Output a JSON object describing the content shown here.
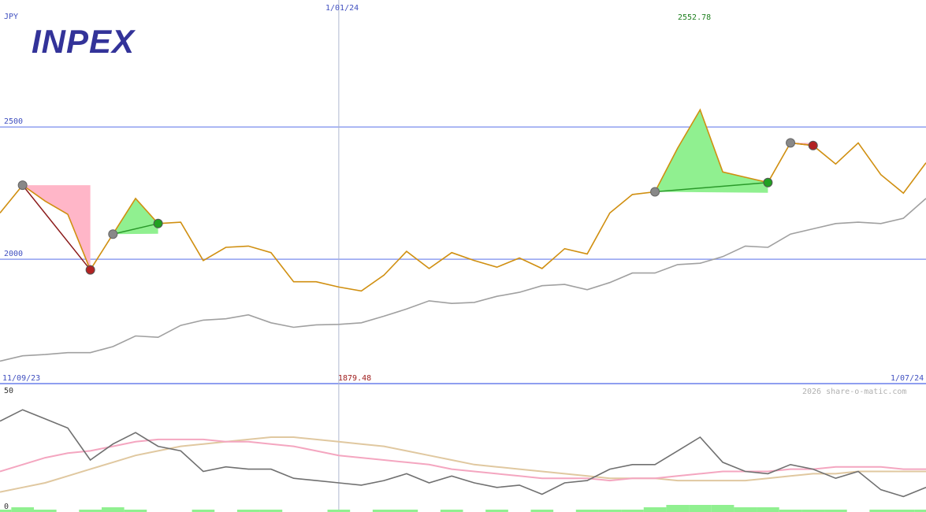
{
  "logo_text": "INPEX",
  "colors": {
    "price": "#d08f10",
    "ma": "#a0a0a0",
    "grid": "#8f9ff0",
    "axis_text": "#4050c0",
    "max_text": "#208020",
    "min_text": "#a02020",
    "logo": "#333399",
    "up": "#90f090",
    "down": "#ffb6c8",
    "osc": "#707070",
    "osc_pink": "#f4a6c0",
    "osc_tan": "#e0c8a0",
    "volume": "#90f090"
  },
  "chart_data": [
    {
      "type": "line",
      "currency_label": "JPY",
      "date_start": "11/09/23",
      "date_end": "1/07/24",
      "vline_label": "1/01/24",
      "max_label": "2552.78",
      "min_label": "1879.48",
      "yticks": [
        2000,
        2500
      ],
      "ylim": [
        1530,
        2980
      ],
      "series": [
        {
          "values": [
            2175,
            2280,
            2220,
            2170,
            1960,
            2095,
            2230,
            2135,
            2140,
            1995,
            2045,
            2050,
            2025,
            1915,
            1915,
            1895,
            1880,
            1940,
            2030,
            1965,
            2025,
            1995,
            1970,
            2005,
            1965,
            2040,
            2020,
            2175,
            2245,
            2255,
            2420,
            2565,
            2330,
            2310,
            2290,
            2440,
            2430,
            2360,
            2440,
            2320,
            2250,
            2365
          ]
        },
        {
          "values": [
            1615,
            1635,
            1640,
            1647,
            1647,
            1670,
            1710,
            1705,
            1750,
            1770,
            1775,
            1790,
            1760,
            1743,
            1752,
            1754,
            1760,
            1785,
            1812,
            1843,
            1833,
            1837,
            1860,
            1875,
            1900,
            1905,
            1885,
            1912,
            1948,
            1948,
            1980,
            1985,
            2010,
            2050,
            2045,
            2095,
            2115,
            2135,
            2140,
            2135,
            2155,
            2230
          ]
        }
      ],
      "signals": [
        {
          "type": "sell",
          "from": 1,
          "to": 4
        },
        {
          "type": "buy",
          "from": 5,
          "to": 7
        },
        {
          "type": "buy",
          "from": 29,
          "to": 34
        },
        {
          "type": "sell",
          "from": 35,
          "to": 36
        }
      ]
    },
    {
      "type": "line",
      "ylim": [
        0,
        50
      ],
      "yticks": [
        0,
        50
      ],
      "credit": "2026 share-o-matic.com",
      "series": [
        {
          "values": [
            37,
            42,
            38,
            34,
            20,
            27,
            32,
            26,
            24,
            15,
            17,
            16,
            16,
            12,
            11,
            10,
            9,
            11,
            14,
            10,
            13,
            10,
            8,
            9,
            5,
            10,
            11,
            16,
            18,
            18,
            24,
            30,
            19,
            15,
            14,
            18,
            16,
            12,
            15,
            7,
            4,
            8
          ]
        },
        {
          "values": [
            15,
            18,
            21,
            23,
            24,
            26,
            28,
            29,
            29,
            29,
            28,
            28,
            27,
            26,
            24,
            22,
            21,
            20,
            19,
            18,
            16,
            15,
            14,
            13,
            12,
            12,
            12,
            11,
            12,
            12,
            13,
            14,
            15,
            15,
            15,
            16,
            16,
            17,
            17,
            17,
            16,
            16
          ]
        },
        {
          "values": [
            6,
            8,
            10,
            13,
            16,
            19,
            22,
            24,
            26,
            27,
            28,
            29,
            30,
            30,
            29,
            28,
            27,
            26,
            24,
            22,
            20,
            18,
            17,
            16,
            15,
            14,
            13,
            12,
            12,
            12,
            11,
            11,
            11,
            11,
            12,
            13,
            14,
            14,
            15,
            15,
            15,
            15
          ]
        }
      ],
      "volume_bars": [
        1,
        2,
        1,
        0,
        1,
        2,
        1,
        0,
        0,
        1,
        0,
        1,
        1,
        0,
        0,
        1,
        0,
        1,
        1,
        0,
        1,
        0,
        1,
        0,
        1,
        0,
        1,
        1,
        1,
        2,
        3,
        3,
        3,
        2,
        2,
        1,
        1,
        1,
        0,
        1,
        1,
        1
      ]
    }
  ]
}
